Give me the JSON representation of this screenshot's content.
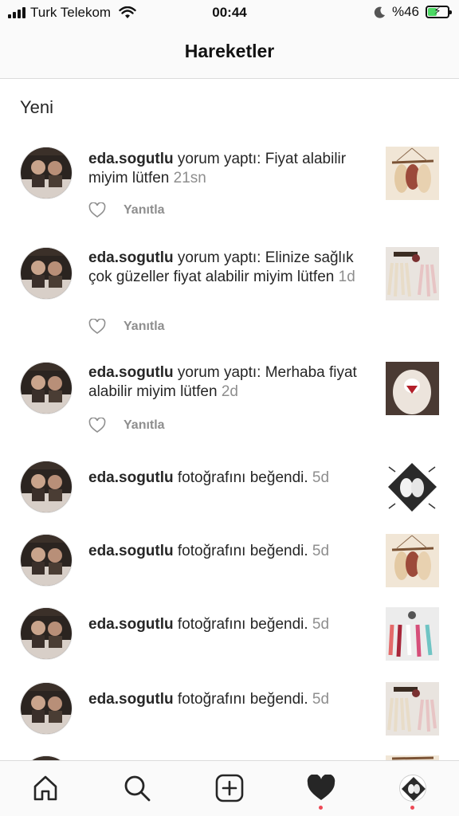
{
  "status_bar": {
    "carrier": "Turk Telekom",
    "time": "00:44",
    "battery_percent": "%46",
    "battery_level": 0.46
  },
  "header": {
    "title": "Hareketler"
  },
  "section": {
    "title": "Yeni"
  },
  "reply_label": "Yanıtla",
  "activities": [
    {
      "username": "eda.sogutlu",
      "text": " yorum yaptı: Fiyat alabilir miyim lütfen ",
      "time": "21sn",
      "has_reply": true
    },
    {
      "username": "eda.sogutlu",
      "text": " yorum yaptı: Elinize sağlık çok güzeller fiyat alabilir miyim lütfen ",
      "time": "1d",
      "has_reply": true
    },
    {
      "username": "eda.sogutlu",
      "text": " yorum yaptı: Merhaba fiyat alabilir miyim lütfen ",
      "time": "2d",
      "has_reply": true
    },
    {
      "username": "eda.sogutlu",
      "text": " fotoğrafını beğendi. ",
      "time": "5d",
      "has_reply": false
    },
    {
      "username": "eda.sogutlu",
      "text": " fotoğrafını beğendi. ",
      "time": "5d",
      "has_reply": false
    },
    {
      "username": "eda.sogutlu",
      "text": " fotoğrafını beğendi. ",
      "time": "5d",
      "has_reply": false
    },
    {
      "username": "eda.sogutlu",
      "text": " fotoğrafını beğendi. ",
      "time": "5d",
      "has_reply": false
    }
  ],
  "tabs": [
    {
      "name": "home-icon"
    },
    {
      "name": "search-icon"
    },
    {
      "name": "new-post-icon"
    },
    {
      "name": "activity-heart-icon",
      "active": true
    },
    {
      "name": "profile-avatar"
    }
  ],
  "colors": {
    "accent_dot": "#ed4956",
    "secondary_text": "#8e8e8e",
    "battery_green": "#4cd964"
  }
}
